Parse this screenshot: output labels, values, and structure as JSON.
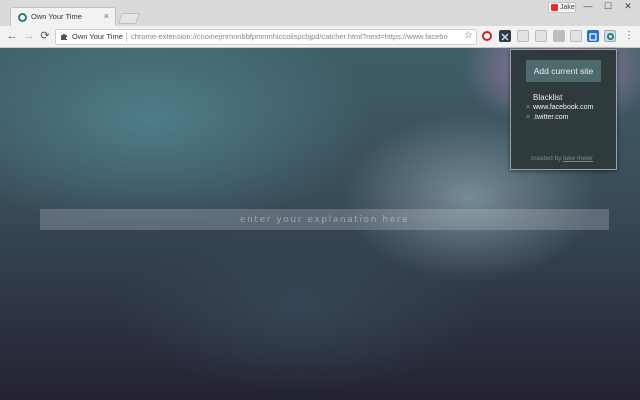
{
  "browser": {
    "tab": {
      "title": "Own Your Time",
      "close": "×"
    },
    "profile_label": "Jake",
    "window_controls": {
      "minimize": "—",
      "maximize": "☐",
      "close": "✕"
    },
    "nav": {
      "back": "←",
      "forward": "→",
      "reload": "⟳"
    },
    "omnibox": {
      "chip_label": "Own Your Time",
      "url": "chrome-extension://cnoinejmmnnbbfpmnmhiccoiispcbjpd/catcher.html?next=https://www.facebo",
      "star": "☆"
    },
    "extensions": [
      "opera-o-icon",
      "dark-ext-icon",
      "camera-ext-icon",
      "printer-ext-icon",
      "gray-ext-icon",
      "blue-ext-icon",
      "own-your-time-icon"
    ],
    "menu": "⋮"
  },
  "main": {
    "explain_placeholder": "enter your explanation here"
  },
  "popup": {
    "add_button": "Add current site",
    "blacklist_title": "Blacklist",
    "blacklist": [
      {
        "remove": "×",
        "site": "www.facebook.com"
      },
      {
        "remove": "×",
        "site": ".twitter.com"
      }
    ],
    "credit_prefix": "created by",
    "credit_link": "luke meier"
  },
  "colors": {
    "accent": "#2c7a78",
    "popup_bg": "#2f3a3d",
    "button_bg": "#4d6a6d"
  }
}
